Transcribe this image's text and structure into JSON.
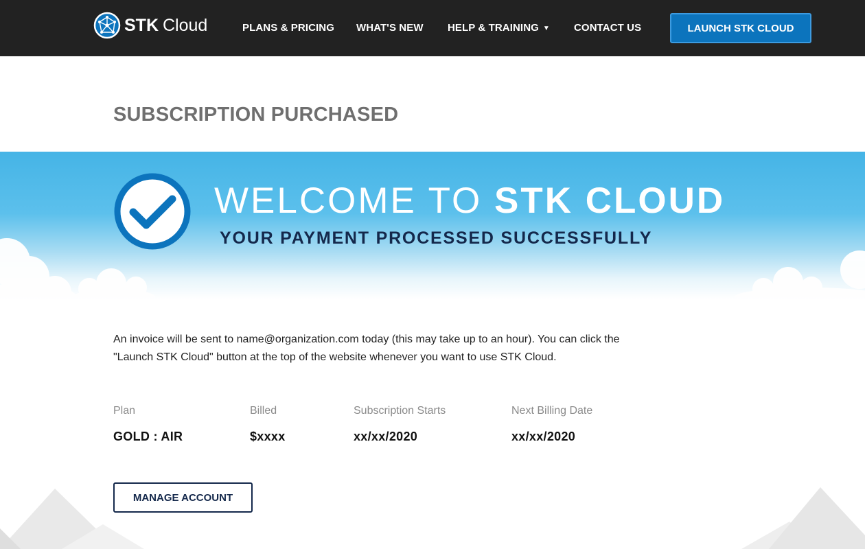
{
  "header": {
    "brand_bold": "STK",
    "brand_light": "Cloud",
    "nav": {
      "plans": "PLANS & PRICING",
      "whats_new": "WHAT'S NEW",
      "help": "HELP & TRAINING",
      "contact": "CONTACT US"
    },
    "launch_label": "LAUNCH STK CLOUD"
  },
  "page_title": "SUBSCRIPTION PURCHASED",
  "hero": {
    "title_light": "WELCOME TO",
    "title_bold": "STK CLOUD",
    "subtitle": "YOUR PAYMENT PROCESSED SUCCESSFULLY"
  },
  "invoice": {
    "line1": "An invoice will be sent to name@organization.com today (this may take up to an hour). You can click the",
    "line2": "\"Launch STK Cloud\" button at the top of the website whenever you want to use STK Cloud."
  },
  "subscription": {
    "plan_label": "Plan",
    "plan_value": "GOLD :  AIR",
    "billed_label": "Billed",
    "billed_value": "$xxxx",
    "start_label": "Subscription Starts",
    "start_value": "xx/xx/2020",
    "next_label": "Next Billing Date",
    "next_value": "xx/xx/2020"
  },
  "manage_label": "MANAGE ACCOUNT",
  "icons": {
    "logo": "network-globe-icon",
    "caret": "chevron-down-icon",
    "success": "checkmark-circle-icon"
  },
  "colors": {
    "navbar_bg": "#222222",
    "accent_blue": "#0c74bd",
    "navy": "#14284b",
    "hero_sky": "#45b4e6",
    "title_gray": "#6f6f6f"
  }
}
